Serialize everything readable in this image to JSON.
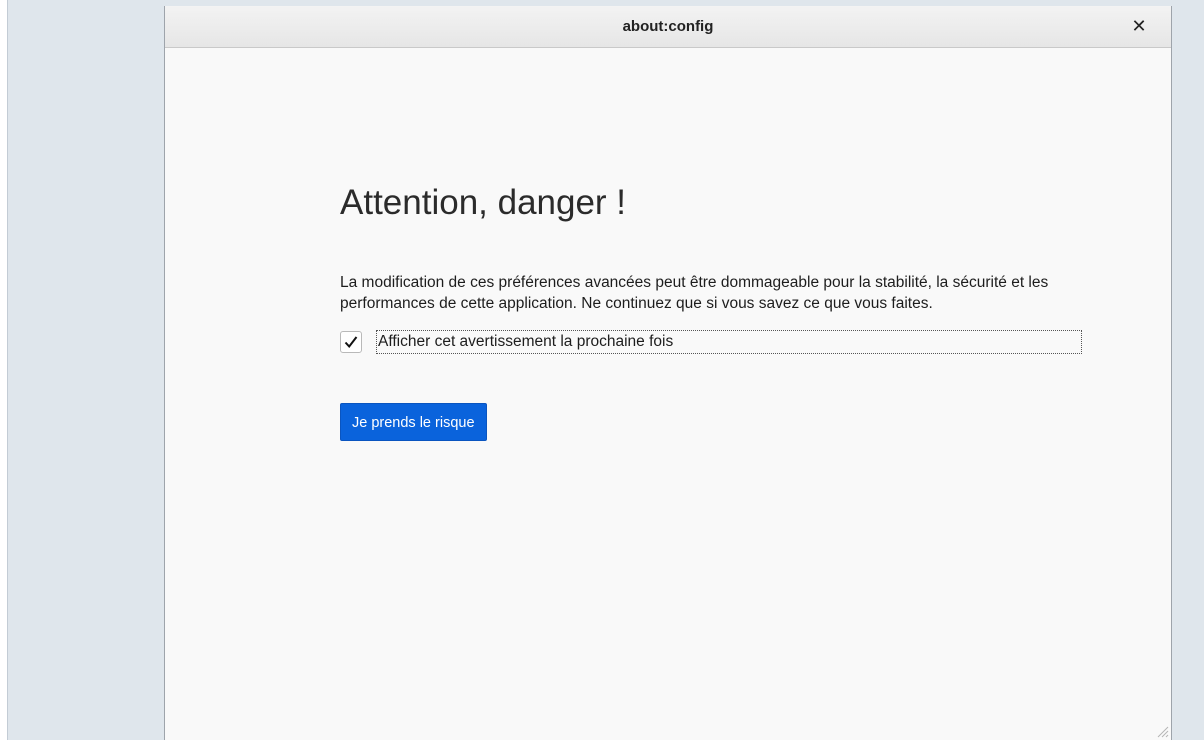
{
  "window": {
    "title": "about:config",
    "close_icon": "close-icon"
  },
  "warning": {
    "heading": "Attention, danger !",
    "message": "La modification de ces préférences avancées peut être dommageable pour la stabilité, la sécurité et les performances de cette application. Ne continuez que si vous savez ce que vous faites.",
    "checkbox": {
      "label": "Afficher cet avertissement la prochaine fois",
      "checked": true
    },
    "accept_button": "Je prends le risque"
  },
  "colors": {
    "accent": "#0a63dc",
    "background": "#f9f9f9",
    "desktop": "#dfe6ec"
  }
}
